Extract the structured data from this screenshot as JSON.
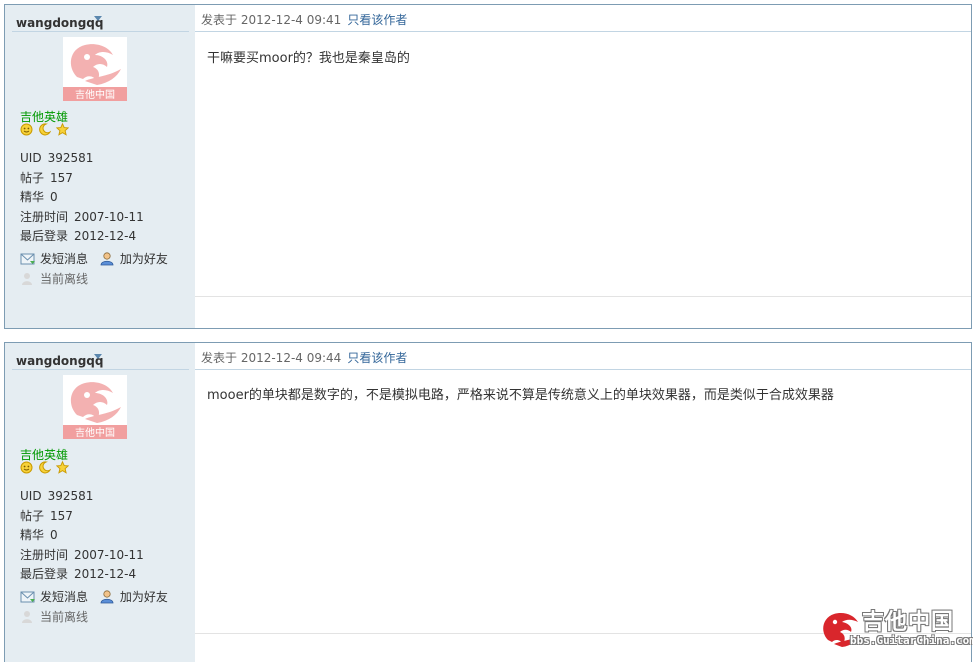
{
  "posts": [
    {
      "username": "wangdongqq",
      "avatar_caption": "吉他中国",
      "rank": "吉他英雄",
      "stats": [
        {
          "label": "UID",
          "value": "392581"
        },
        {
          "label": "帖子",
          "value": "157"
        },
        {
          "label": "精华",
          "value": "0"
        },
        {
          "label": "注册时间",
          "value": "2007-10-11"
        },
        {
          "label": "最后登录",
          "value": "2012-12-4"
        }
      ],
      "actions": {
        "message": "发短消息",
        "add_friend": "加为好友",
        "status": "当前离线"
      },
      "time": "发表于 2012-12-4 09:41",
      "author_only": "只看该作者",
      "content": "干嘛要买moor的？我也是秦皇岛的"
    },
    {
      "username": "wangdongqq",
      "avatar_caption": "吉他中国",
      "rank": "吉他英雄",
      "stats": [
        {
          "label": "UID",
          "value": "392581"
        },
        {
          "label": "帖子",
          "value": "157"
        },
        {
          "label": "精华",
          "value": "0"
        },
        {
          "label": "注册时间",
          "value": "2007-10-11"
        },
        {
          "label": "最后登录",
          "value": "2012-12-4"
        }
      ],
      "actions": {
        "message": "发短消息",
        "add_friend": "加为好友",
        "status": "当前离线"
      },
      "time": "发表于 2012-12-4 09:44",
      "author_only": "只看该作者",
      "content": "mooer的单块都是数字的，不是模拟电路，严格来说不算是传统意义上的单块效果器，而是类似于合成效果器"
    }
  ],
  "watermark": {
    "title": "吉他中国",
    "url": "bbs.GuitarChina.com"
  },
  "colors": {
    "sidebar": "#e5edf2",
    "border": "#7d9cb3",
    "rank": "#009900",
    "link": "#336699"
  }
}
